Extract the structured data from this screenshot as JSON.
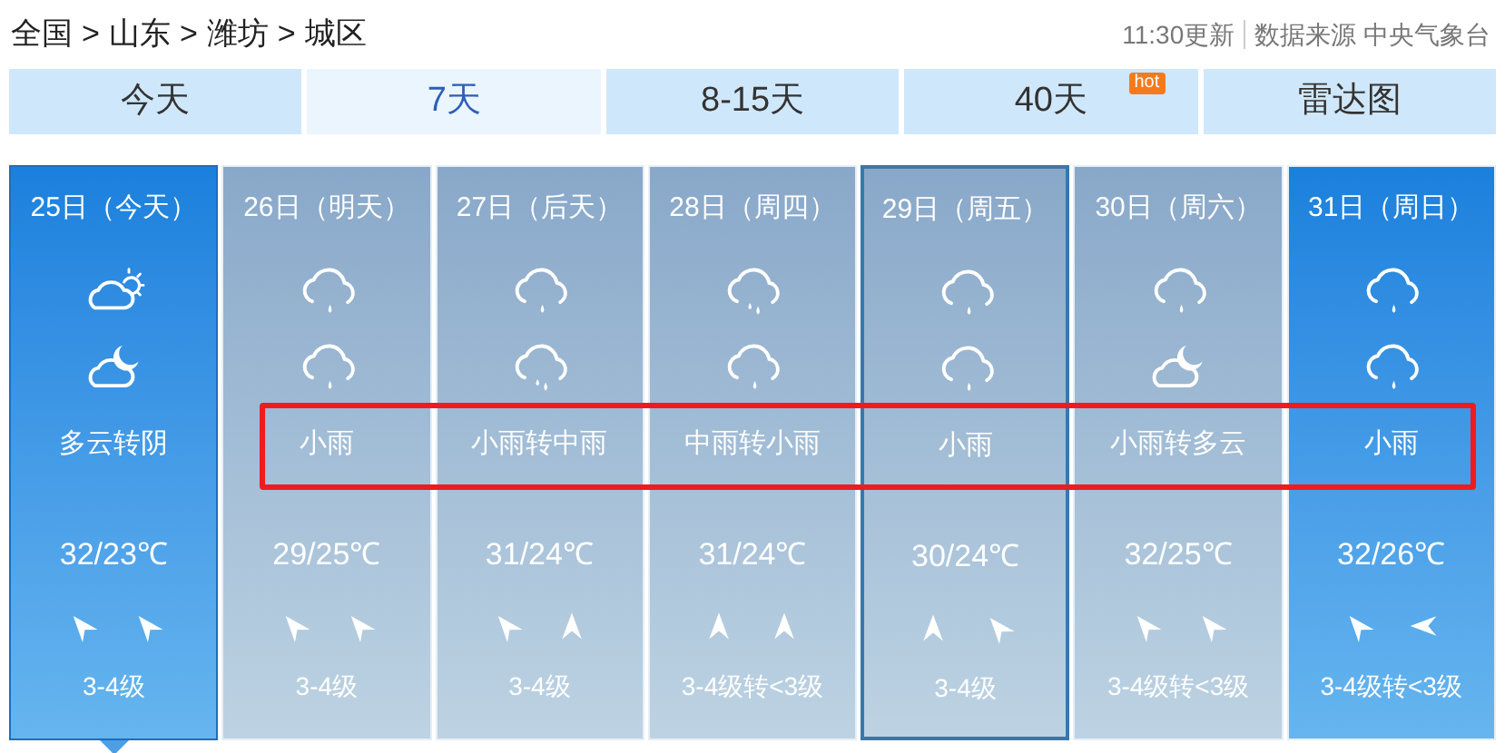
{
  "breadcrumb": [
    "全国",
    "山东",
    "潍坊",
    "城区"
  ],
  "breadcrumb_separator": ">",
  "update_time": "11:30更新",
  "source": "数据来源 中央气象台",
  "tabs": [
    {
      "label": "今天",
      "selected": false
    },
    {
      "label": "7天",
      "selected": true
    },
    {
      "label": "8-15天",
      "selected": false
    },
    {
      "label": "40天",
      "selected": false,
      "badge": "hot"
    },
    {
      "label": "雷达图",
      "selected": false
    }
  ],
  "red_box": true,
  "days": [
    {
      "date": "25日（今天）",
      "kind": "blue",
      "selected": true,
      "outlined": false,
      "icons": [
        {
          "kind": "cloudsun"
        },
        {
          "kind": "cloudmoon"
        }
      ],
      "weather": "多云转阴",
      "temp": "32/23℃",
      "wind_arrows": [
        {
          "kind": "northwest"
        },
        {
          "kind": "northwest"
        }
      ],
      "wind": "3-4级"
    },
    {
      "date": "26日（明天）",
      "kind": "grey",
      "selected": false,
      "outlined": false,
      "icons": [
        {
          "kind": "drizzle"
        },
        {
          "kind": "drizzle"
        }
      ],
      "weather": "小雨",
      "temp": "29/25℃",
      "wind_arrows": [
        {
          "kind": "northwest"
        },
        {
          "kind": "northwest"
        }
      ],
      "wind": "3-4级"
    },
    {
      "date": "27日（后天）",
      "kind": "grey",
      "selected": false,
      "outlined": false,
      "icons": [
        {
          "kind": "drizzle"
        },
        {
          "kind": "rain"
        }
      ],
      "weather": "小雨转中雨",
      "temp": "31/24℃",
      "wind_arrows": [
        {
          "kind": "northwest"
        },
        {
          "kind": "north"
        }
      ],
      "wind": "3-4级"
    },
    {
      "date": "28日（周四）",
      "kind": "grey",
      "selected": false,
      "outlined": false,
      "icons": [
        {
          "kind": "rain"
        },
        {
          "kind": "drizzle"
        }
      ],
      "weather": "中雨转小雨",
      "temp": "31/24℃",
      "wind_arrows": [
        {
          "kind": "north"
        },
        {
          "kind": "north"
        }
      ],
      "wind": "3-4级转<3级"
    },
    {
      "date": "29日（周五）",
      "kind": "grey",
      "selected": false,
      "outlined": true,
      "icons": [
        {
          "kind": "drizzle"
        },
        {
          "kind": "drizzle"
        }
      ],
      "weather": "小雨",
      "temp": "30/24℃",
      "wind_arrows": [
        {
          "kind": "north"
        },
        {
          "kind": "northwest"
        }
      ],
      "wind": "3-4级"
    },
    {
      "date": "30日（周六）",
      "kind": "grey",
      "selected": false,
      "outlined": false,
      "icons": [
        {
          "kind": "drizzle"
        },
        {
          "kind": "cloudmoon"
        }
      ],
      "weather": "小雨转多云",
      "temp": "32/25℃",
      "wind_arrows": [
        {
          "kind": "northwest"
        },
        {
          "kind": "northwest"
        }
      ],
      "wind": "3-4级转<3级"
    },
    {
      "date": "31日（周日）",
      "kind": "blue",
      "selected": false,
      "outlined": false,
      "icons": [
        {
          "kind": "drizzle"
        },
        {
          "kind": "drizzle"
        }
      ],
      "weather": "小雨",
      "temp": "32/26℃",
      "wind_arrows": [
        {
          "kind": "northwest"
        },
        {
          "kind": "west"
        }
      ],
      "wind": "3-4级转<3级"
    }
  ]
}
